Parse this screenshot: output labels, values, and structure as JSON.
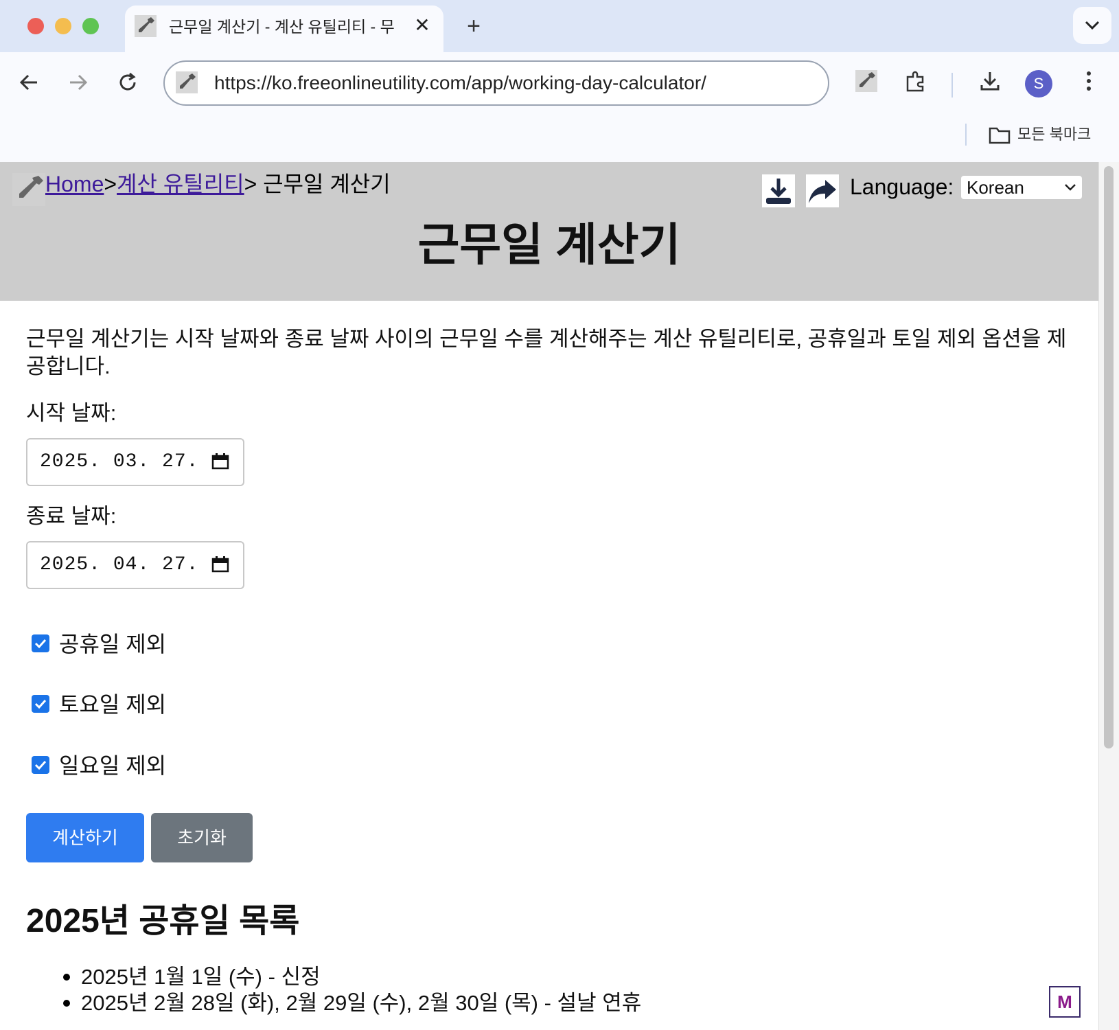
{
  "browser": {
    "tab_title": "근무일 계산기 - 계산 유틸리티 - 무",
    "tab_close": "✕",
    "new_tab": "+",
    "url": "https://ko.freeonlineutility.com/app/working-day-calculator/",
    "profile_initial": "S",
    "bookmarks_label": "모든 북마크"
  },
  "breadcrumb": {
    "home": "Home",
    "sep1": ">",
    "category": "계산 유틸리티",
    "current": "> 근무일 계산기"
  },
  "header": {
    "language_label": "Language:",
    "language_value": "Korean",
    "title": "근무일 계산기"
  },
  "main": {
    "intro": "근무일 계산기는 시작 날짜와 종료 날짜 사이의 근무일 수를 계산해주는 계산 유틸리티로, 공휴일과 토일 제외 옵션을 제공합니다.",
    "start_label": "시작 날짜:",
    "start_value": "2025. 03. 27.",
    "end_label": "종료 날짜:",
    "end_value": "2025. 04. 27.",
    "options": [
      {
        "label": "공휴일 제외",
        "checked": true
      },
      {
        "label": "토요일 제외",
        "checked": true
      },
      {
        "label": "일요일 제외",
        "checked": true
      }
    ],
    "calc_button": "계산하기",
    "reset_button": "초기화",
    "holidays_title": "2025년 공휴일 목록",
    "holidays": [
      "2025년 1월 1일 (수) - 신정",
      "2025년 2월 28일 (화), 2월 29일 (수), 2월 30일 (목) - 설날 연휴"
    ]
  },
  "colors": {
    "tabbar_bg": "#dde6f7",
    "header_bg": "#cccccc",
    "primary_button": "#2f7cf0",
    "secondary_button": "#6c757d",
    "link": "#3d1a9a"
  }
}
